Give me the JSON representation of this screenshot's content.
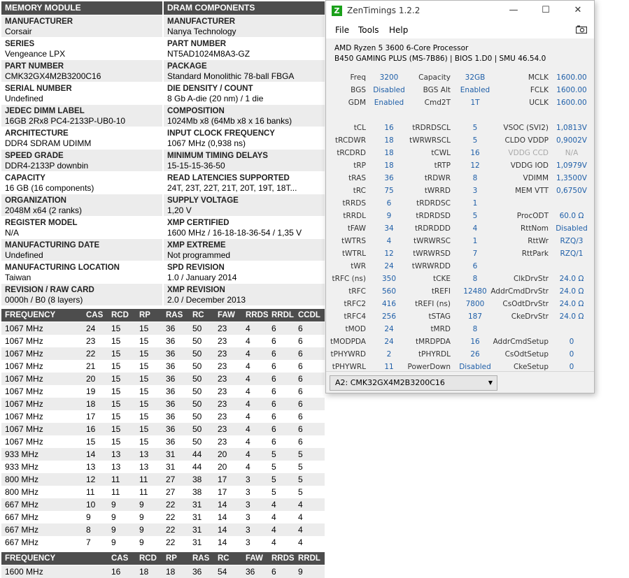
{
  "report": {
    "left_header": "MEMORY MODULE",
    "right_header": "DRAM COMPONENTS",
    "left": [
      {
        "label": "MANUFACTURER",
        "value": "Corsair"
      },
      {
        "label": "SERIES",
        "value": "Vengeance LPX"
      },
      {
        "label": "PART NUMBER",
        "value": "CMK32GX4M2B3200C16"
      },
      {
        "label": "SERIAL NUMBER",
        "value": "Undefined"
      },
      {
        "label": "JEDEC DIMM LABEL",
        "value": "16GB 2Rx8 PC4-2133P-UB0-10"
      },
      {
        "label": "ARCHITECTURE",
        "value": "DDR4 SDRAM UDIMM"
      },
      {
        "label": "SPEED GRADE",
        "value": "DDR4-2133P downbin"
      },
      {
        "label": "CAPACITY",
        "value": "16 GB (16 components)"
      },
      {
        "label": "ORGANIZATION",
        "value": "2048M x64 (2 ranks)"
      },
      {
        "label": "REGISTER MODEL",
        "value": "N/A"
      },
      {
        "label": "MANUFACTURING DATE",
        "value": "Undefined"
      },
      {
        "label": "MANUFACTURING LOCATION",
        "value": "Taiwan"
      },
      {
        "label": "REVISION / RAW CARD",
        "value": "0000h / B0 (8 layers)"
      }
    ],
    "right": [
      {
        "label": "MANUFACTURER",
        "value": "Nanya Technology"
      },
      {
        "label": "PART NUMBER",
        "value": "NT5AD1024M8A3-GZ"
      },
      {
        "label": "PACKAGE",
        "value": "Standard Monolithic 78-ball FBGA"
      },
      {
        "label": "DIE DENSITY / COUNT",
        "value": "8 Gb A-die (20 nm) / 1 die"
      },
      {
        "label": "COMPOSITION",
        "value": "1024Mb x8 (64Mb x8 x 16 banks)"
      },
      {
        "label": "INPUT CLOCK FREQUENCY",
        "value": "1067 MHz (0,938 ns)"
      },
      {
        "label": "MINIMUM TIMING DELAYS",
        "value": "15-15-15-36-50"
      },
      {
        "label": "READ LATENCIES SUPPORTED",
        "value": "24T, 23T, 22T, 21T, 20T, 19T, 18T..."
      },
      {
        "label": "SUPPLY VOLTAGE",
        "value": "1,20 V"
      },
      {
        "label": "XMP CERTIFIED",
        "value": "1600 MHz / 16-18-18-36-54 / 1,35 V"
      },
      {
        "label": "XMP EXTREME",
        "value": "Not programmed"
      },
      {
        "label": "SPD REVISION",
        "value": "1.0 / January 2014"
      },
      {
        "label": "XMP REVISION",
        "value": "2.0 / December 2013"
      }
    ],
    "jedec_table": {
      "headers": [
        "FREQUENCY",
        "CAS",
        "RCD",
        "RP",
        "RAS",
        "RC",
        "FAW",
        "RRDS",
        "RRDL",
        "CCDL"
      ],
      "rows": [
        [
          "1067 MHz",
          "24",
          "15",
          "15",
          "36",
          "50",
          "23",
          "4",
          "6",
          "6"
        ],
        [
          "1067 MHz",
          "23",
          "15",
          "15",
          "36",
          "50",
          "23",
          "4",
          "6",
          "6"
        ],
        [
          "1067 MHz",
          "22",
          "15",
          "15",
          "36",
          "50",
          "23",
          "4",
          "6",
          "6"
        ],
        [
          "1067 MHz",
          "21",
          "15",
          "15",
          "36",
          "50",
          "23",
          "4",
          "6",
          "6"
        ],
        [
          "1067 MHz",
          "20",
          "15",
          "15",
          "36",
          "50",
          "23",
          "4",
          "6",
          "6"
        ],
        [
          "1067 MHz",
          "19",
          "15",
          "15",
          "36",
          "50",
          "23",
          "4",
          "6",
          "6"
        ],
        [
          "1067 MHz",
          "18",
          "15",
          "15",
          "36",
          "50",
          "23",
          "4",
          "6",
          "6"
        ],
        [
          "1067 MHz",
          "17",
          "15",
          "15",
          "36",
          "50",
          "23",
          "4",
          "6",
          "6"
        ],
        [
          "1067 MHz",
          "16",
          "15",
          "15",
          "36",
          "50",
          "23",
          "4",
          "6",
          "6"
        ],
        [
          "1067 MHz",
          "15",
          "15",
          "15",
          "36",
          "50",
          "23",
          "4",
          "6",
          "6"
        ],
        [
          "933 MHz",
          "14",
          "13",
          "13",
          "31",
          "44",
          "20",
          "4",
          "5",
          "5"
        ],
        [
          "933 MHz",
          "13",
          "13",
          "13",
          "31",
          "44",
          "20",
          "4",
          "5",
          "5"
        ],
        [
          "800 MHz",
          "12",
          "11",
          "11",
          "27",
          "38",
          "17",
          "3",
          "5",
          "5"
        ],
        [
          "800 MHz",
          "11",
          "11",
          "11",
          "27",
          "38",
          "17",
          "3",
          "5",
          "5"
        ],
        [
          "667 MHz",
          "10",
          "9",
          "9",
          "22",
          "31",
          "14",
          "3",
          "4",
          "4"
        ],
        [
          "667 MHz",
          "9",
          "9",
          "9",
          "22",
          "31",
          "14",
          "3",
          "4",
          "4"
        ],
        [
          "667 MHz",
          "8",
          "9",
          "9",
          "22",
          "31",
          "14",
          "3",
          "4",
          "4"
        ],
        [
          "667 MHz",
          "7",
          "9",
          "9",
          "22",
          "31",
          "14",
          "3",
          "4",
          "4"
        ]
      ]
    },
    "xmp_table": {
      "headers": [
        "FREQUENCY",
        "",
        "CAS",
        "RCD",
        "RP",
        "RAS",
        "RC",
        "FAW",
        "RRDS",
        "RRDL"
      ],
      "rows": [
        [
          "1600 MHz",
          "",
          "16",
          "18",
          "18",
          "36",
          "54",
          "36",
          "6",
          "9"
        ]
      ]
    }
  },
  "zentimings": {
    "title": "ZenTimings 1.2.2",
    "logo_letter": "Z",
    "window_buttons": {
      "minimize": "—",
      "maximize": "☐",
      "close": "✕"
    },
    "menu": [
      "File",
      "Tools",
      "Help"
    ],
    "cpu_line": "AMD Ryzen 5 3600 6-Core Processor",
    "board_line": "B450 GAMING PLUS (MS-7B86) | BIOS 1.D0 | SMU 46.54.0",
    "col1": [
      {
        "label": "Freq",
        "value": "3200"
      },
      {
        "label": "BGS",
        "value": "Disabled"
      },
      {
        "label": "GDM",
        "value": "Enabled"
      },
      {
        "label": "",
        "value": ""
      },
      {
        "label": "tCL",
        "value": "16"
      },
      {
        "label": "tRCDWR",
        "value": "18"
      },
      {
        "label": "tRCDRD",
        "value": "18"
      },
      {
        "label": "tRP",
        "value": "18"
      },
      {
        "label": "tRAS",
        "value": "36"
      },
      {
        "label": "tRC",
        "value": "75"
      },
      {
        "label": "tRRDS",
        "value": "6"
      },
      {
        "label": "tRRDL",
        "value": "9"
      },
      {
        "label": "tFAW",
        "value": "34"
      },
      {
        "label": "tWTRS",
        "value": "4"
      },
      {
        "label": "tWTRL",
        "value": "12"
      },
      {
        "label": "tWR",
        "value": "24"
      },
      {
        "label": "tRFC (ns)",
        "value": "350"
      },
      {
        "label": "tRFC",
        "value": "560"
      },
      {
        "label": "tRFC2",
        "value": "416"
      },
      {
        "label": "tRFC4",
        "value": "256"
      },
      {
        "label": "tMOD",
        "value": "24"
      },
      {
        "label": "tMODPDA",
        "value": "24"
      },
      {
        "label": "tPHYWRD",
        "value": "2"
      },
      {
        "label": "tPHYWRL",
        "value": "11"
      }
    ],
    "col2": [
      {
        "label": "Capacity",
        "value": "32GB"
      },
      {
        "label": "BGS Alt",
        "value": "Enabled"
      },
      {
        "label": "Cmd2T",
        "value": "1T"
      },
      {
        "label": "",
        "value": ""
      },
      {
        "label": "tRDRDSCL",
        "value": "5"
      },
      {
        "label": "tWRWRSCL",
        "value": "5"
      },
      {
        "label": "tCWL",
        "value": "16"
      },
      {
        "label": "tRTP",
        "value": "12"
      },
      {
        "label": "tRDWR",
        "value": "8"
      },
      {
        "label": "tWRRD",
        "value": "3"
      },
      {
        "label": "tRDRDSC",
        "value": "1"
      },
      {
        "label": "tRDRDSD",
        "value": "5"
      },
      {
        "label": "tRDRDDD",
        "value": "4"
      },
      {
        "label": "tWRWRSC",
        "value": "1"
      },
      {
        "label": "tWRWRSD",
        "value": "7"
      },
      {
        "label": "tWRWRDD",
        "value": "6"
      },
      {
        "label": "tCKE",
        "value": "8"
      },
      {
        "label": "tREFI",
        "value": "12480"
      },
      {
        "label": "tREFI (ns)",
        "value": "7800"
      },
      {
        "label": "tSTAG",
        "value": "187"
      },
      {
        "label": "tMRD",
        "value": "8"
      },
      {
        "label": "tMRDPDA",
        "value": "16"
      },
      {
        "label": "tPHYRDL",
        "value": "26"
      },
      {
        "label": "PowerDown",
        "value": "Disabled"
      }
    ],
    "col3": [
      {
        "label": "MCLK",
        "value": "1600.00"
      },
      {
        "label": "FCLK",
        "value": "1600.00"
      },
      {
        "label": "UCLK",
        "value": "1600.00"
      },
      {
        "label": "",
        "value": ""
      },
      {
        "label": "VSOC (SVI2)",
        "value": "1,0813V"
      },
      {
        "label": "CLDO VDDP",
        "value": "0,9002V"
      },
      {
        "label": "VDDG CCD",
        "value": "N/A",
        "disabled": true
      },
      {
        "label": "VDDG IOD",
        "value": "1,0979V"
      },
      {
        "label": "VDIMM",
        "value": "1,3500V"
      },
      {
        "label": "MEM VTT",
        "value": "0,6750V"
      },
      {
        "label": "",
        "value": ""
      },
      {
        "label": "ProcODT",
        "value": "60.0 Ω"
      },
      {
        "label": "RttNom",
        "value": "Disabled"
      },
      {
        "label": "RttWr",
        "value": "RZQ/3"
      },
      {
        "label": "RttPark",
        "value": "RZQ/1"
      },
      {
        "label": "",
        "value": ""
      },
      {
        "label": "ClkDrvStr",
        "value": "24.0 Ω"
      },
      {
        "label": "AddrCmdDrvStr",
        "value": "24.0 Ω"
      },
      {
        "label": "CsOdtDrvStr",
        "value": "24.0 Ω"
      },
      {
        "label": "CkeDrvStr",
        "value": "24.0 Ω"
      },
      {
        "label": "",
        "value": ""
      },
      {
        "label": "AddrCmdSetup",
        "value": "0"
      },
      {
        "label": "CsOdtSetup",
        "value": "0"
      },
      {
        "label": "CkeSetup",
        "value": "0"
      }
    ],
    "dimm_select": "A2: CMK32GX4M2B3200C16",
    "colors": {
      "value": "#1f5fa8",
      "disabled": "#a9a9a9",
      "header_bg": "#4d4d4d",
      "shade": "#ececec",
      "logo": "#1aa11a"
    }
  }
}
